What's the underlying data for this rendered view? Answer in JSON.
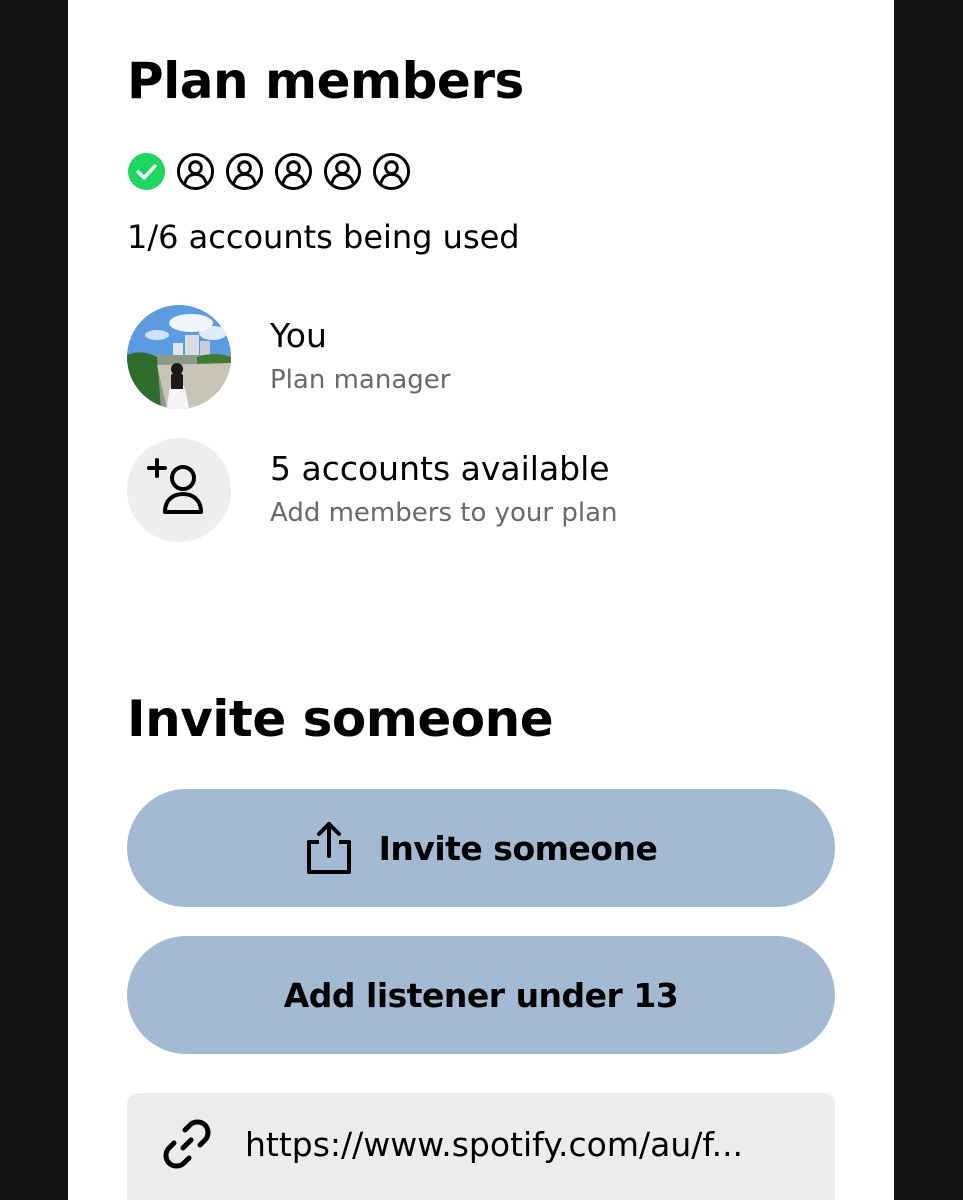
{
  "plan_members": {
    "title": "Plan members",
    "slots_total": 6,
    "slots_used": 1,
    "usage_text": "1/6 accounts being used",
    "colors": {
      "used_slot": "#1ed760",
      "empty_slot": "#000000"
    },
    "members": [
      {
        "name": "You",
        "role": "Plan manager",
        "avatar": "user-photo"
      },
      {
        "name": "5 accounts available",
        "role": "Add members to your plan",
        "icon": "add-person-icon"
      }
    ]
  },
  "invite": {
    "title": "Invite someone",
    "invite_button_label": "Invite someone",
    "invite_button_icon": "share-icon",
    "under13_button_label": "Add listener under 13",
    "link_icon": "link-icon",
    "link_text": "https://www.spotify.com/au/f...",
    "colors": {
      "button_bg": "#a4bad2",
      "link_bg": "#ececec"
    }
  }
}
